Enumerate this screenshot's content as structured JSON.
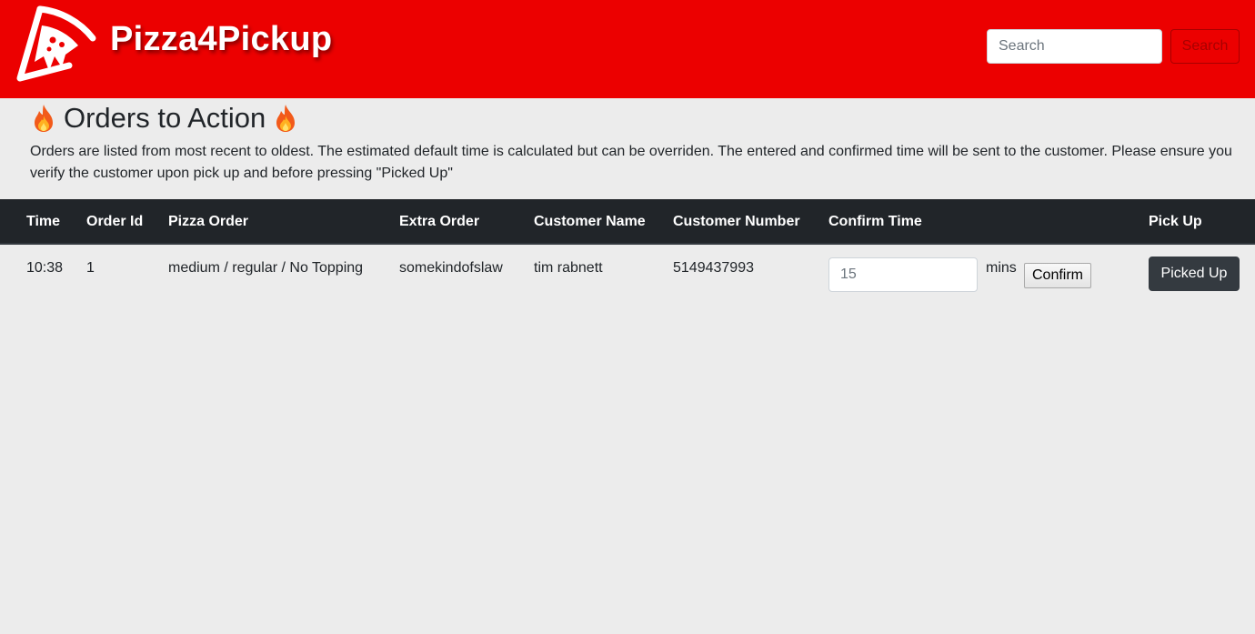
{
  "header": {
    "brand": "Pizza4Pickup",
    "logo_icon": "pizza-slice-icon",
    "search_placeholder": "Search",
    "search_button": "Search",
    "colors": {
      "navbar": "#ec0000",
      "search_button": "#a80000"
    }
  },
  "page": {
    "title": "Orders to Action",
    "title_icon": "fire-icon",
    "intro": "Orders are listed from most recent to oldest. The estimated default time is calculated but can be overriden. The entered and confirmed time will be sent to the customer. Please ensure you verify the customer upon pick up and before pressing \"Picked Up\""
  },
  "table": {
    "headers": {
      "time": "Time",
      "order_id": "Order Id",
      "pizza_order": "Pizza Order",
      "extra_order": "Extra Order",
      "customer_name": "Customer Name",
      "customer_number": "Customer Number",
      "confirm_time": "Confirm Time",
      "pick_up": "Pick Up"
    },
    "rows": [
      {
        "time": "10:38",
        "order_id": "1",
        "pizza_order": "medium / regular / No Topping",
        "extra_order": "somekindofslaw",
        "customer_name": "tim rabnett",
        "customer_number": "5149437993",
        "confirm_placeholder": "15",
        "mins_label": "mins",
        "confirm_button": "Confirm",
        "picked_up_button": "Picked Up"
      }
    ],
    "colors": {
      "header_bg": "#212529",
      "picked_button": "#343a40"
    }
  }
}
